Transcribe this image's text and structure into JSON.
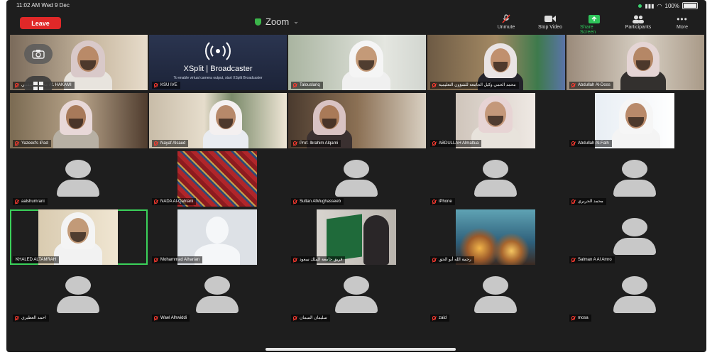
{
  "status_bar": {
    "time_date": "11:02 AM   Wed 9 Dec",
    "battery": "100%"
  },
  "header": {
    "leave_label": "Leave",
    "app_title": "Zoom",
    "actions": {
      "unmute": "Unmute",
      "stop_video": "Stop Video",
      "share_screen": "Share Screen",
      "participants": "Participants",
      "more": "More"
    },
    "share_screen_color": "#2ec55a",
    "leave_color": "#e02828"
  },
  "xsplit": {
    "brand": "XSplit | Broadcaster",
    "hint": "To enable virtual camera output, start XSplit Broadcaster"
  },
  "participants": [
    {
      "name": "محسن المقمي AL HAKAMI",
      "type": "video"
    },
    {
      "name": "KSU IVE",
      "type": "xsplit"
    },
    {
      "name": "Talouslariq",
      "type": "video"
    },
    {
      "name": "محمد الحمي وكيل الجامعة للشؤون التعليمية",
      "type": "video"
    },
    {
      "name": "Abdullah Al-Doss",
      "type": "video"
    },
    {
      "name": "Yazeed's iPad",
      "type": "video"
    },
    {
      "name": "Nayaf Alsaud",
      "type": "video"
    },
    {
      "name": "Prof. Ibrahim Alqarni",
      "type": "video"
    },
    {
      "name": "ABDULLAH Almaltua",
      "type": "video"
    },
    {
      "name": "Abdullah Al-Falh",
      "type": "video"
    },
    {
      "name": "aalshumrani",
      "type": "avatar"
    },
    {
      "name": "NADA Al-Qahtani",
      "type": "carpet"
    },
    {
      "name": "Sultan AlMughasseeb",
      "type": "avatar"
    },
    {
      "name": "iPhone",
      "type": "avatar"
    },
    {
      "name": "محمد الحربري",
      "type": "avatar"
    },
    {
      "name": "KHALED ALTAMRAH",
      "type": "video",
      "active": true
    },
    {
      "name": "Mohammad Alharian",
      "type": "silhouette"
    },
    {
      "name": "فريق جامعة الملك سعود",
      "type": "flag"
    },
    {
      "name": "رحمة الله أبو الحق",
      "type": "lantern"
    },
    {
      "name": "Salman A Al Amro",
      "type": "avatar"
    },
    {
      "name": "احمد العطيري",
      "type": "avatar"
    },
    {
      "name": "Wael Alhwiddi",
      "type": "avatar"
    },
    {
      "name": "سليمان الميمان",
      "type": "avatar"
    },
    {
      "name": "zaid",
      "type": "avatar"
    },
    {
      "name": "mosa",
      "type": "avatar"
    }
  ]
}
